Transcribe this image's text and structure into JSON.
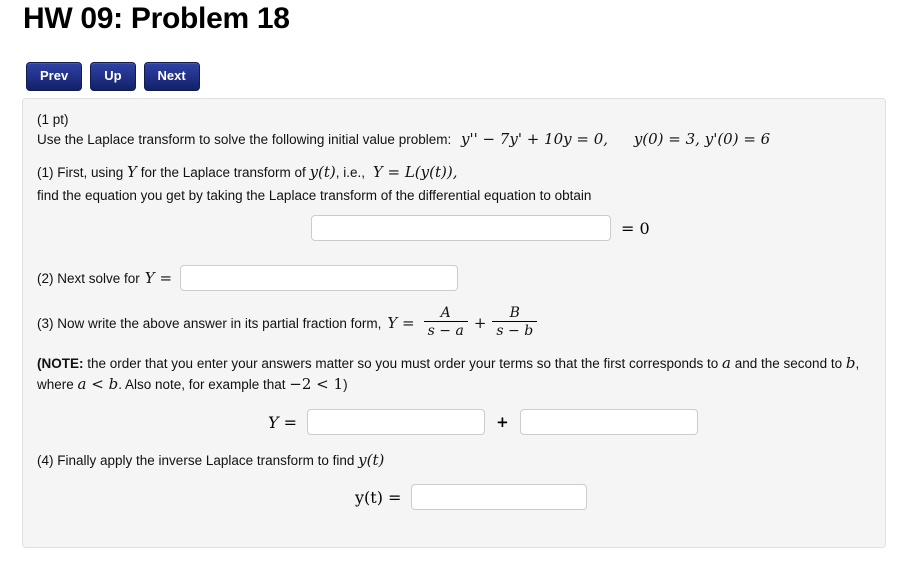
{
  "header": {
    "title": "HW 09: Problem 18"
  },
  "navigation": {
    "prev_label": "Prev",
    "up_label": "Up",
    "next_label": "Next"
  },
  "problem": {
    "points": "(1 pt)",
    "prompt_text": "Use the Laplace transform to solve the following initial value problem:",
    "equation": {
      "ode": "y'' − 7y' + 10y = 0,",
      "initial_conditions": "y(0) = 3,  y'(0) = 6"
    },
    "step1": {
      "line1_a": "(1) First, using",
      "line1_Y": "Y",
      "line1_b": "for the Laplace transform of",
      "line1_yt": "y(t)",
      "line1_c": ", i.e.,",
      "line1_def": "Y = L(y(t)),",
      "line2": "find the equation you get by taking the Laplace transform of the differential equation to obtain",
      "input_value": "",
      "input_placeholder": "",
      "equals_zero": "= 0"
    },
    "step2": {
      "label_a": "(2) Next solve for",
      "label_Y": "Y =",
      "input_value": "",
      "input_placeholder": ""
    },
    "step3": {
      "label": "(3) Now write the above answer in its partial fraction form,",
      "label_Y": "Y =",
      "frac1_num": "A",
      "frac1_den": "s − a",
      "plus": "+",
      "frac2_num": "B",
      "frac2_den": "s − b",
      "note_bold": "NOTE:",
      "note_open": "(",
      "note_text_1": " the order that you enter your answers matter so you must order your terms so that the first corresponds to ",
      "note_var_a": "a",
      "note_text_2": " and the second to ",
      "note_var_b": "b",
      "note_text_3": ", where ",
      "note_ineq1": "a < b",
      "note_text_4": ". Also note, for example that ",
      "note_ineq2": "−2 < 1",
      "note_close": ")",
      "answer_label": "Y =",
      "input_a_value": "",
      "input_a_placeholder": "",
      "separator": "+",
      "input_b_value": "",
      "input_b_placeholder": ""
    },
    "step4": {
      "label_a": "(4) Finally apply the inverse Laplace transform to find",
      "label_yt": "y(t)",
      "answer_label": "y(t) =",
      "input_value": "",
      "input_placeholder": ""
    }
  },
  "colors": {
    "button_blue_top": "#2f43a4",
    "button_blue_bottom": "#132166",
    "panel_background": "#f5f5f5",
    "panel_border": "#e0e0e0",
    "input_border": "#cccccc",
    "text": "#111111"
  }
}
